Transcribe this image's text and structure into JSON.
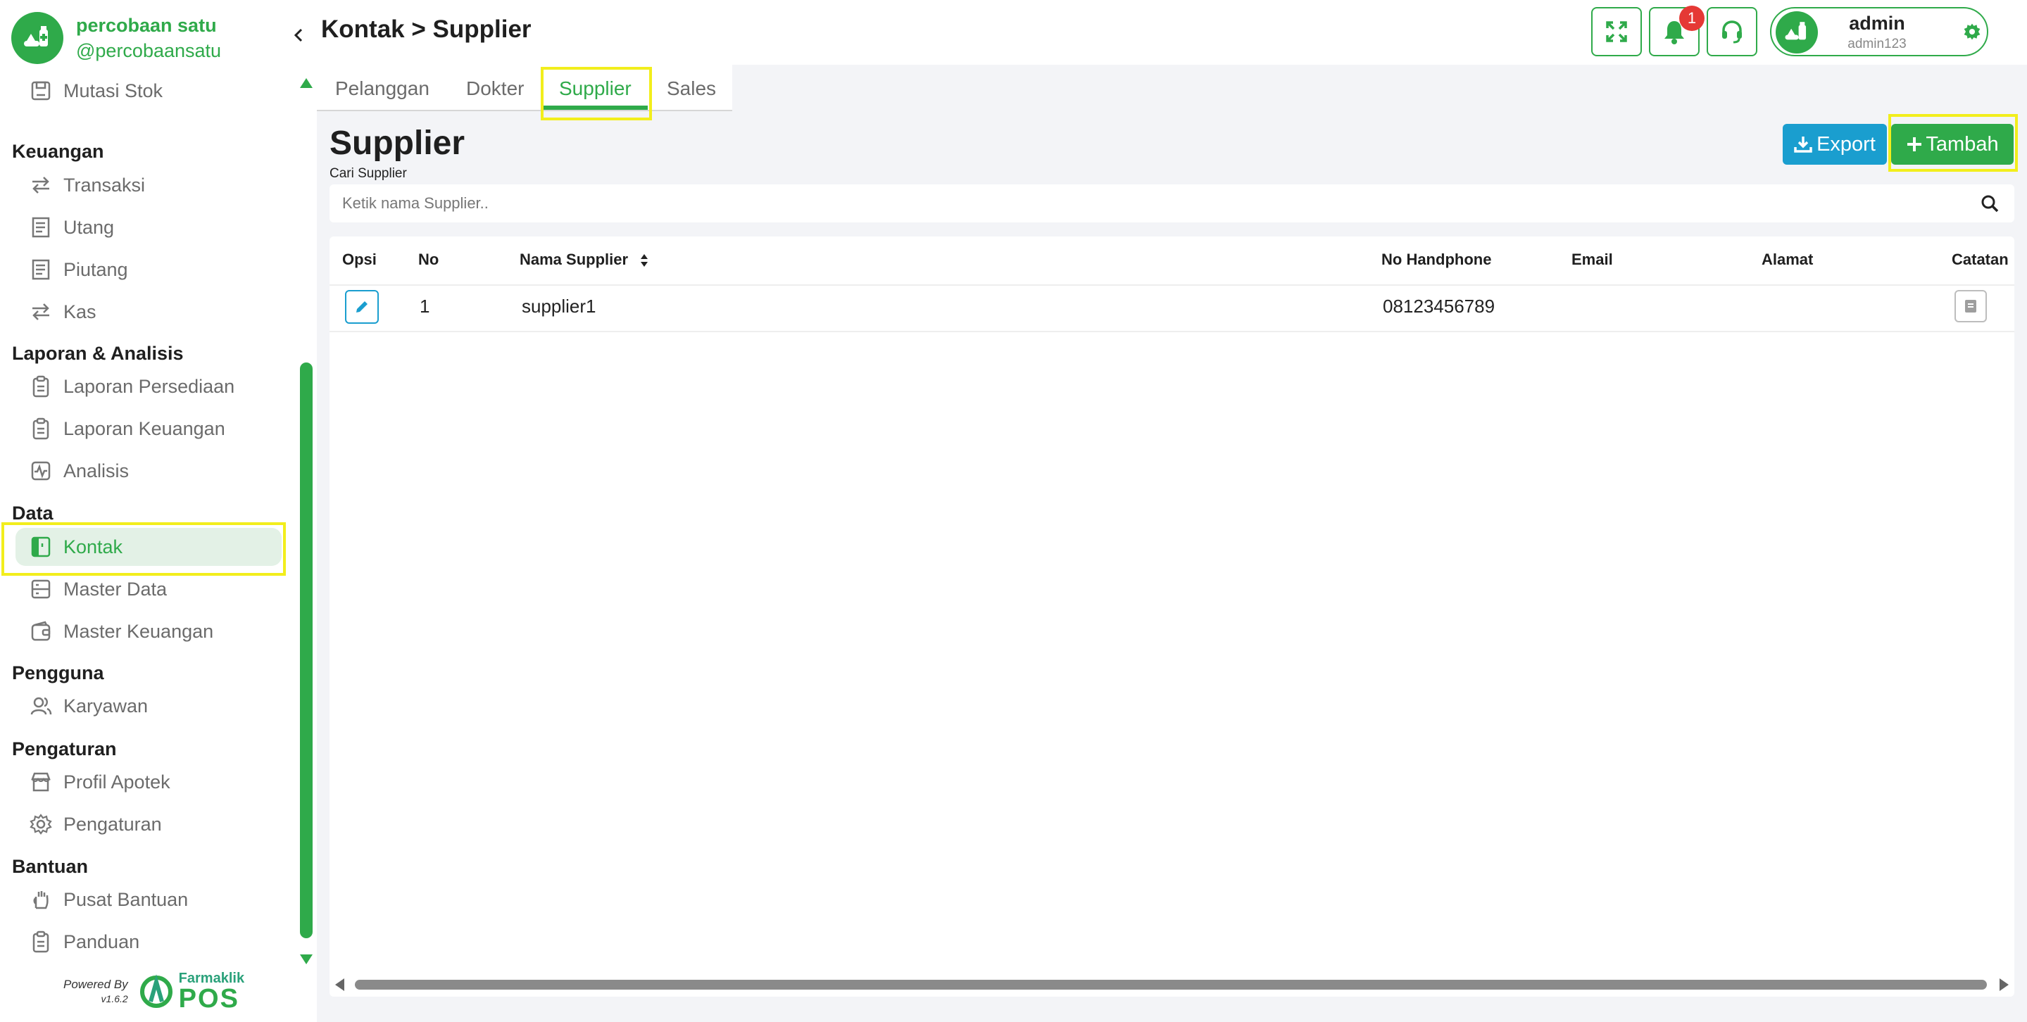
{
  "brand": {
    "name": "percobaan satu",
    "handle": "@percobaansatu"
  },
  "sidebar": {
    "partial_item_label": "Mutasi Stok",
    "sections": [
      {
        "title": "Keuangan",
        "items": [
          {
            "label": "Transaksi",
            "icon": "transfer-icon"
          },
          {
            "label": "Utang",
            "icon": "receipt-icon"
          },
          {
            "label": "Piutang",
            "icon": "receipt-icon"
          },
          {
            "label": "Kas",
            "icon": "transfer-icon"
          }
        ]
      },
      {
        "title": "Laporan & Analisis",
        "items": [
          {
            "label": "Laporan Persediaan",
            "icon": "clipboard-icon"
          },
          {
            "label": "Laporan Keuangan",
            "icon": "clipboard-icon"
          },
          {
            "label": "Analisis",
            "icon": "activity-icon"
          }
        ]
      },
      {
        "title": "Data",
        "items": [
          {
            "label": "Kontak",
            "icon": "contact-book-icon",
            "active": true
          },
          {
            "label": "Master Data",
            "icon": "database-icon"
          },
          {
            "label": "Master Keuangan",
            "icon": "wallet-icon"
          }
        ]
      },
      {
        "title": "Pengguna",
        "items": [
          {
            "label": "Karyawan",
            "icon": "users-icon"
          }
        ]
      },
      {
        "title": "Pengaturan",
        "items": [
          {
            "label": "Profil Apotek",
            "icon": "store-icon"
          },
          {
            "label": "Pengaturan",
            "icon": "gear-icon"
          }
        ]
      },
      {
        "title": "Bantuan",
        "items": [
          {
            "label": "Pusat Bantuan",
            "icon": "hand-icon"
          },
          {
            "label": "Panduan",
            "icon": "clipboard-icon"
          }
        ]
      }
    ],
    "powered_by": "Powered By",
    "version": "v1.6.2",
    "product_small": "Farmaklik",
    "product_big": "POS"
  },
  "header": {
    "breadcrumb": "Kontak > Supplier",
    "notification_count": "1",
    "user_name": "admin",
    "user_id": "admin123"
  },
  "tabs": [
    "Pelanggan",
    "Dokter",
    "Supplier",
    "Sales"
  ],
  "active_tab": "Supplier",
  "page": {
    "title": "Supplier",
    "search_label": "Cari Supplier",
    "search_placeholder": "Ketik nama Supplier..",
    "export_label": "Export",
    "add_label": "Tambah"
  },
  "table": {
    "columns": [
      "Opsi",
      "No",
      "Nama Supplier",
      "No Handphone",
      "Email",
      "Alamat",
      "Catatan"
    ],
    "rows": [
      {
        "no": "1",
        "name": "supplier1",
        "phone": "08123456789",
        "email": "",
        "address": ""
      }
    ]
  },
  "colors": {
    "primary": "#2faa4a",
    "export_button": "#1a9ecf",
    "highlight": "#f2ee1c",
    "badge": "#e53935"
  }
}
